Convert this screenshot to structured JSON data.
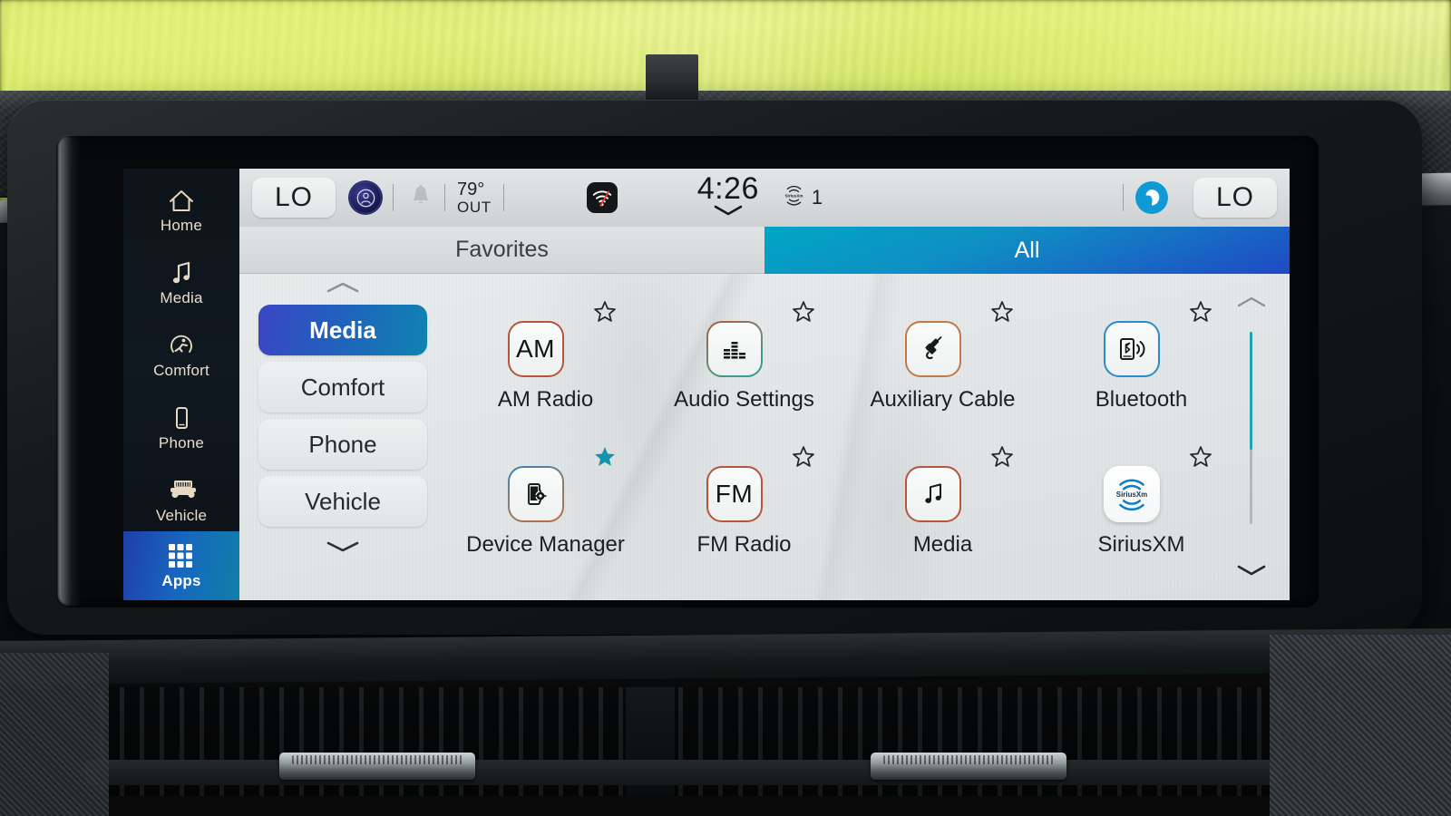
{
  "sidebar": {
    "items": [
      {
        "label": "Home",
        "icon": "home-icon",
        "active": false
      },
      {
        "label": "Media",
        "icon": "music-note-icon",
        "active": false
      },
      {
        "label": "Comfort",
        "icon": "comfort-seat-icon",
        "active": false
      },
      {
        "label": "Phone",
        "icon": "phone-icon",
        "active": false
      },
      {
        "label": "Vehicle",
        "icon": "jeep-vehicle-icon",
        "active": false
      },
      {
        "label": "Apps",
        "icon": "grid-apps-icon",
        "active": true
      }
    ]
  },
  "statusbar": {
    "left_temp_chip": "LO",
    "right_temp_chip": "LO",
    "alexa_badge_icon": "alexa-profile-icon",
    "bell_icon": "bell-icon",
    "outside_temp": "79°",
    "outside_label": "OUT",
    "wifi_icon": "wifi-off-icon",
    "clock": "4:26",
    "clock_chevron_icon": "chevron-down-icon",
    "sxm_signal_icon": "siriusxm-signal-icon",
    "sxm_signal_count": "1",
    "assistant_icon": "alexa-circle-icon"
  },
  "tabs": [
    {
      "label": "Favorites",
      "active": false
    },
    {
      "label": "All",
      "active": true
    }
  ],
  "categories": {
    "scroll_up_icon": "chevron-up-icon",
    "scroll_down_icon": "chevron-down-icon",
    "items": [
      {
        "label": "Media",
        "active": true
      },
      {
        "label": "Comfort",
        "active": false
      },
      {
        "label": "Phone",
        "active": false
      },
      {
        "label": "Vehicle",
        "active": false
      }
    ]
  },
  "apps": [
    {
      "label": "AM Radio",
      "icon": "am-radio-icon",
      "tile_text": "AM",
      "border": "bd-red",
      "favorite": false
    },
    {
      "label": "Audio Settings",
      "icon": "equalizer-icon",
      "tile_text": "",
      "border": "bd-grad",
      "favorite": false
    },
    {
      "label": "Auxiliary Cable",
      "icon": "aux-jack-icon",
      "tile_text": "",
      "border": "bd-orange",
      "favorite": false
    },
    {
      "label": "Bluetooth",
      "icon": "bluetooth-phone-icon",
      "tile_text": "",
      "border": "bd-blue",
      "favorite": false
    },
    {
      "label": "Device Manager",
      "icon": "device-manager-icon",
      "tile_text": "",
      "border": "bd-mix",
      "favorite": true
    },
    {
      "label": "FM Radio",
      "icon": "fm-radio-icon",
      "tile_text": "FM",
      "border": "bd-red",
      "favorite": false
    },
    {
      "label": "Media",
      "icon": "music-note-icon",
      "tile_text": "",
      "border": "bd-red",
      "favorite": false
    },
    {
      "label": "SiriusXM",
      "icon": "siriusxm-logo-icon",
      "tile_text": "",
      "border": "solid-white",
      "favorite": false
    }
  ],
  "scrollbar": {
    "up_icon": "chevron-up-icon",
    "down_icon": "chevron-down-icon"
  },
  "colors": {
    "accent_blue": "#1f49c4",
    "accent_teal": "#00a6c4",
    "favorite_star": "#1592ae",
    "sidebar_icon": "#e6d9c2",
    "wifi_slash": "#e03a2f"
  }
}
